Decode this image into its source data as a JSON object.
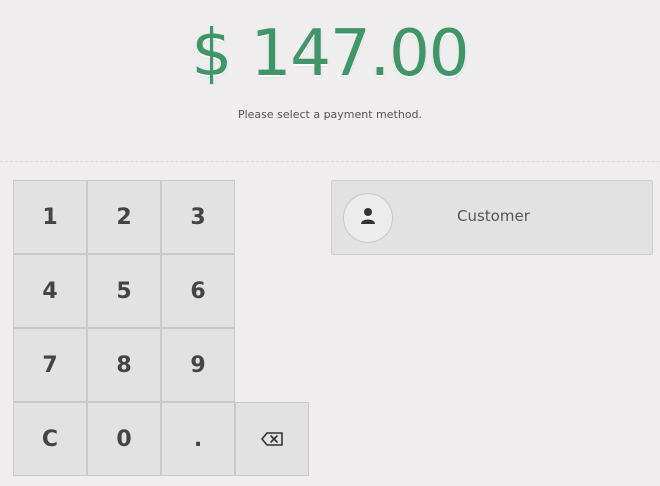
{
  "payment": {
    "amount": "$ 147.00",
    "hint": "Please select a payment method."
  },
  "numpad": {
    "keys": [
      "1",
      "2",
      "3",
      "4",
      "5",
      "6",
      "7",
      "8",
      "9",
      "C",
      "0",
      "."
    ],
    "backspace_icon": "backspace-icon"
  },
  "customer": {
    "label": "Customer",
    "icon": "user-icon"
  },
  "colors": {
    "amount": "#3f9669",
    "background": "#efedee",
    "key": "#e2e2e2"
  }
}
